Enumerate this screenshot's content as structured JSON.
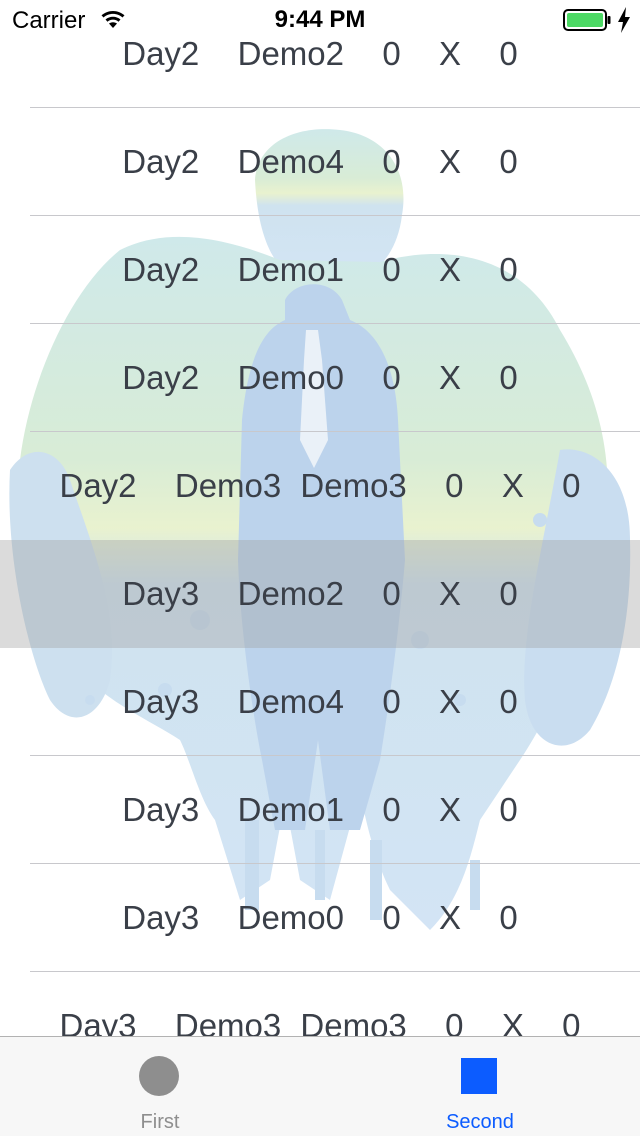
{
  "status_bar": {
    "carrier": "Carrier",
    "time": "9:44 PM",
    "wifi_icon": "wifi-icon",
    "battery_icon": "battery-icon",
    "charging_icon": "bolt-icon",
    "battery_color": "#4cd964"
  },
  "list": {
    "rows": [
      {
        "label": "Day2  Demo2  0  X  0"
      },
      {
        "label": "Day2  Demo4  0  X  0"
      },
      {
        "label": "Day2  Demo1  0  X  0"
      },
      {
        "label": "Day2  Demo0  0  X  0"
      },
      {
        "label": "Day2  Demo3 Demo3  0  X  0"
      },
      {
        "label": "Day3  Demo2  0  X  0"
      },
      {
        "label": "Day3  Demo4  0  X  0"
      },
      {
        "label": "Day3  Demo1  0  X  0"
      },
      {
        "label": "Day3  Demo0  0  X  0"
      },
      {
        "label": "Day3  Demo3 Demo3  0  X  0"
      }
    ],
    "selected_index": 5
  },
  "tab_bar": {
    "tabs": [
      {
        "label": "First",
        "icon": "circle-icon",
        "selected": false
      },
      {
        "label": "Second",
        "icon": "square-icon",
        "selected": true
      }
    ],
    "accent_color": "#0c5cff",
    "inactive_color": "#8e8e8e"
  }
}
